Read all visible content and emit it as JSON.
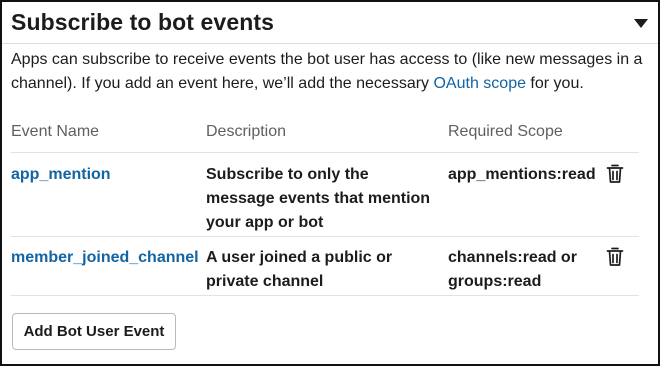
{
  "section": {
    "title": "Subscribe to bot events",
    "description_text": "Apps can subscribe to receive events the bot user has access to (like new messages in a channel). If you add an event here, we’ll add the necessary ",
    "description_link": "OAuth scope",
    "description_suffix": " for you."
  },
  "table": {
    "headers": {
      "event_name": "Event Name",
      "description": "Description",
      "required_scope": "Required Scope"
    },
    "rows": [
      {
        "event_name": "app_mention",
        "description": "Subscribe to only the message events that mention your app or bot",
        "scope": "app_mentions:read",
        "action_icon": "trash-icon"
      },
      {
        "event_name": "member_joined_channel",
        "description": "A user joined a public or private channel",
        "scope": "channels:read or groups:read",
        "action_icon": "trash-icon"
      }
    ]
  },
  "add_button": {
    "label": "Add Bot User Event"
  },
  "colors": {
    "link": "#1264a3",
    "text": "#1d1c1d",
    "muted": "#616061"
  }
}
